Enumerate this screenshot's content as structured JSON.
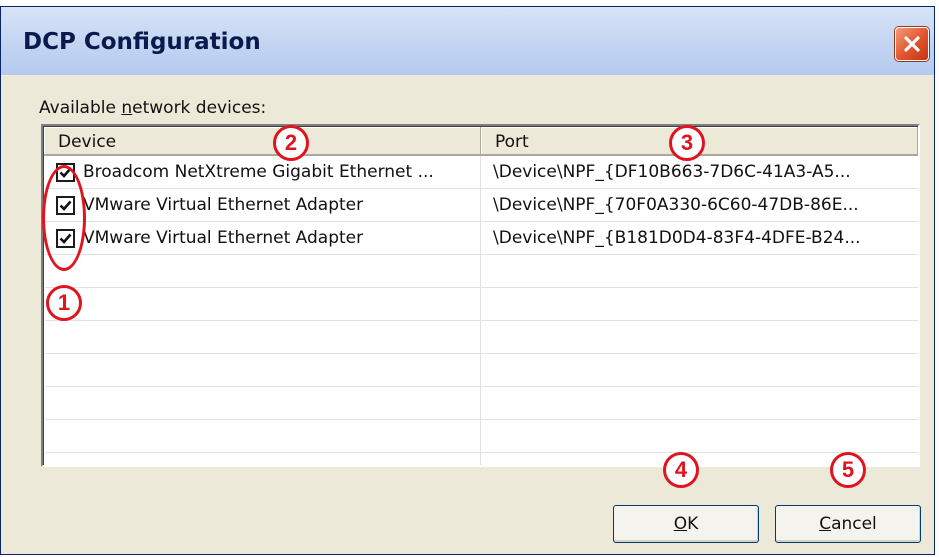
{
  "window": {
    "title": "DCP Configuration"
  },
  "label": {
    "prefix": "Available ",
    "mnemonic": "n",
    "suffix": "etwork devices:"
  },
  "columns": {
    "device": "Device",
    "port": "Port"
  },
  "rows": [
    {
      "checked": true,
      "device": "Broadcom NetXtreme Gigabit Ethernet ...",
      "port": "\\Device\\NPF_{DF10B663-7D6C-41A3-A5..."
    },
    {
      "checked": true,
      "device": "VMware Virtual Ethernet Adapter",
      "port": "\\Device\\NPF_{70F0A330-6C60-47DB-86E..."
    },
    {
      "checked": true,
      "device": "VMware Virtual Ethernet Adapter",
      "port": "\\Device\\NPF_{B181D0D4-83F4-4DFE-B24..."
    }
  ],
  "buttons": {
    "ok": {
      "mnemonic": "O",
      "rest": "K"
    },
    "cancel": {
      "mnemonic": "C",
      "rest": "ancel"
    }
  },
  "callouts": [
    "1",
    "2",
    "3",
    "4",
    "5"
  ],
  "colors": {
    "callout": "#e0141e",
    "dialog_bg": "#ece9d8",
    "title_text": "#0a1a4d"
  },
  "icons": {
    "close": "close-icon",
    "checkbox": "checkmark-icon"
  }
}
